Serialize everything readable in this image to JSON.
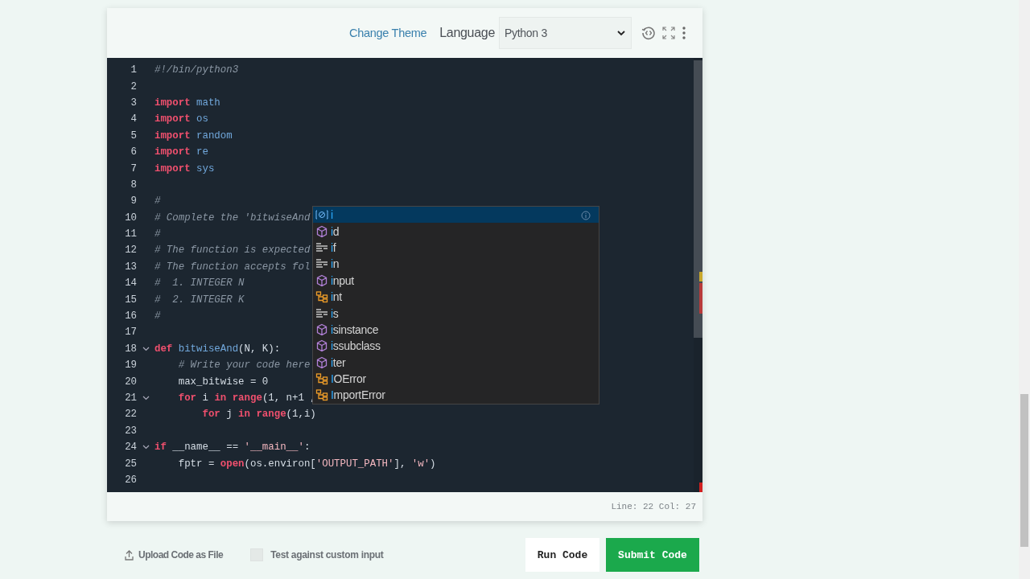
{
  "header": {
    "theme_link": "Change Theme",
    "language_label": "Language",
    "language_value": "Python 3"
  },
  "editor": {
    "lines": [
      {
        "number": "1",
        "foldable": false,
        "tokens": [
          {
            "kind": "comment",
            "text": "#!/bin/python3"
          }
        ]
      },
      {
        "number": "2",
        "foldable": false
      },
      {
        "number": "3",
        "foldable": false,
        "tokens": [
          {
            "kind": "keyword",
            "text": "import"
          },
          {
            "kind": "name",
            "text": " math"
          }
        ]
      },
      {
        "number": "4",
        "foldable": false,
        "tokens": [
          {
            "kind": "keyword",
            "text": "import"
          },
          {
            "kind": "name",
            "text": " os"
          }
        ]
      },
      {
        "number": "5",
        "foldable": false,
        "tokens": [
          {
            "kind": "keyword",
            "text": "import"
          },
          {
            "kind": "name",
            "text": " random"
          }
        ]
      },
      {
        "number": "6",
        "foldable": false,
        "tokens": [
          {
            "kind": "keyword",
            "text": "import"
          },
          {
            "kind": "name",
            "text": " re"
          }
        ]
      },
      {
        "number": "7",
        "foldable": false,
        "tokens": [
          {
            "kind": "keyword",
            "text": "import"
          },
          {
            "kind": "name",
            "text": " sys"
          }
        ]
      },
      {
        "number": "8",
        "foldable": false
      },
      {
        "number": "9",
        "foldable": false,
        "tokens": [
          {
            "kind": "comment",
            "text": "#"
          }
        ]
      },
      {
        "number": "10",
        "foldable": false,
        "tokens": [
          {
            "kind": "comment",
            "text": "# Complete the 'bitwiseAnd"
          }
        ]
      },
      {
        "number": "11",
        "foldable": false,
        "tokens": [
          {
            "kind": "comment",
            "text": "#"
          }
        ]
      },
      {
        "number": "12",
        "foldable": false,
        "tokens": [
          {
            "kind": "comment",
            "text": "# The function is expected"
          }
        ]
      },
      {
        "number": "13",
        "foldable": false,
        "tokens": [
          {
            "kind": "comment",
            "text": "# The function accepts fol"
          }
        ]
      },
      {
        "number": "14",
        "foldable": false,
        "tokens": [
          {
            "kind": "comment",
            "text": "#  1. INTEGER N"
          }
        ]
      },
      {
        "number": "15",
        "foldable": false,
        "tokens": [
          {
            "kind": "comment",
            "text": "#  2. INTEGER K"
          }
        ]
      },
      {
        "number": "16",
        "foldable": false,
        "tokens": [
          {
            "kind": "comment",
            "text": "#"
          }
        ]
      },
      {
        "number": "17",
        "foldable": false
      },
      {
        "number": "18",
        "foldable": true,
        "tokens": [
          {
            "kind": "keyword",
            "text": "def"
          },
          {
            "kind": "name",
            "text": " bitwiseAnd"
          },
          {
            "kind": "plain",
            "text": "(N, K):"
          }
        ]
      },
      {
        "number": "19",
        "foldable": false,
        "tokens": [
          {
            "kind": "comment",
            "text": "    # Write your code here"
          }
        ]
      },
      {
        "number": "20",
        "foldable": false,
        "tokens": [
          {
            "kind": "plain",
            "text": "    max_bitwise = 0"
          }
        ]
      },
      {
        "number": "21",
        "foldable": true,
        "tokens": [
          {
            "kind": "keyword",
            "text": "    for"
          },
          {
            "kind": "plain",
            "text": " i "
          },
          {
            "kind": "keyword",
            "text": "in"
          },
          {
            "kind": "function",
            "text": " range"
          },
          {
            "kind": "plain",
            "text": "(1, n+1 ,"
          }
        ]
      },
      {
        "number": "22",
        "foldable": false,
        "tokens": [
          {
            "kind": "keyword",
            "text": "        for"
          },
          {
            "kind": "plain",
            "text": " j "
          },
          {
            "kind": "keyword",
            "text": "in"
          },
          {
            "kind": "function",
            "text": " range"
          },
          {
            "kind": "plain",
            "text": "(1,i)"
          }
        ]
      },
      {
        "number": "23",
        "foldable": false
      },
      {
        "number": "24",
        "foldable": true,
        "tokens": [
          {
            "kind": "keyword",
            "text": "if"
          },
          {
            "kind": "plain",
            "text": " __name__ == "
          },
          {
            "kind": "string",
            "text": "'__main__'"
          },
          {
            "kind": "plain",
            "text": ":"
          }
        ]
      },
      {
        "number": "25",
        "foldable": false,
        "tokens": [
          {
            "kind": "plain",
            "text": "    fptr = "
          },
          {
            "kind": "function",
            "text": "open"
          },
          {
            "kind": "plain",
            "text": "(os.environ["
          },
          {
            "kind": "string",
            "text": "'OUTPUT_PATH'"
          },
          {
            "kind": "plain",
            "text": "], "
          },
          {
            "kind": "string",
            "text": "'w'"
          },
          {
            "kind": "plain",
            "text": ")"
          }
        ]
      },
      {
        "number": "26",
        "foldable": false
      }
    ],
    "suggestions": [
      {
        "label": "i",
        "kind": "variable",
        "selected": true
      },
      {
        "label": "id",
        "kind": "function",
        "selected": false
      },
      {
        "label": "if",
        "kind": "keyword",
        "selected": false
      },
      {
        "label": "in",
        "kind": "keyword",
        "selected": false
      },
      {
        "label": "input",
        "kind": "function",
        "selected": false
      },
      {
        "label": "int",
        "kind": "class",
        "selected": false
      },
      {
        "label": "is",
        "kind": "keyword",
        "selected": false
      },
      {
        "label": "isinstance",
        "kind": "function",
        "selected": false
      },
      {
        "label": "issubclass",
        "kind": "function",
        "selected": false
      },
      {
        "label": "iter",
        "kind": "function",
        "selected": false
      },
      {
        "label": "IOError",
        "kind": "class",
        "selected": false
      },
      {
        "label": "ImportError",
        "kind": "class",
        "selected": false
      }
    ],
    "status": "Line: 22 Col: 27"
  },
  "footer": {
    "upload": "Upload Code as File",
    "custom_input": {
      "label": "Test against custom input",
      "checked": false
    },
    "run_button": "Run Code",
    "submit_button": "Submit Code"
  }
}
